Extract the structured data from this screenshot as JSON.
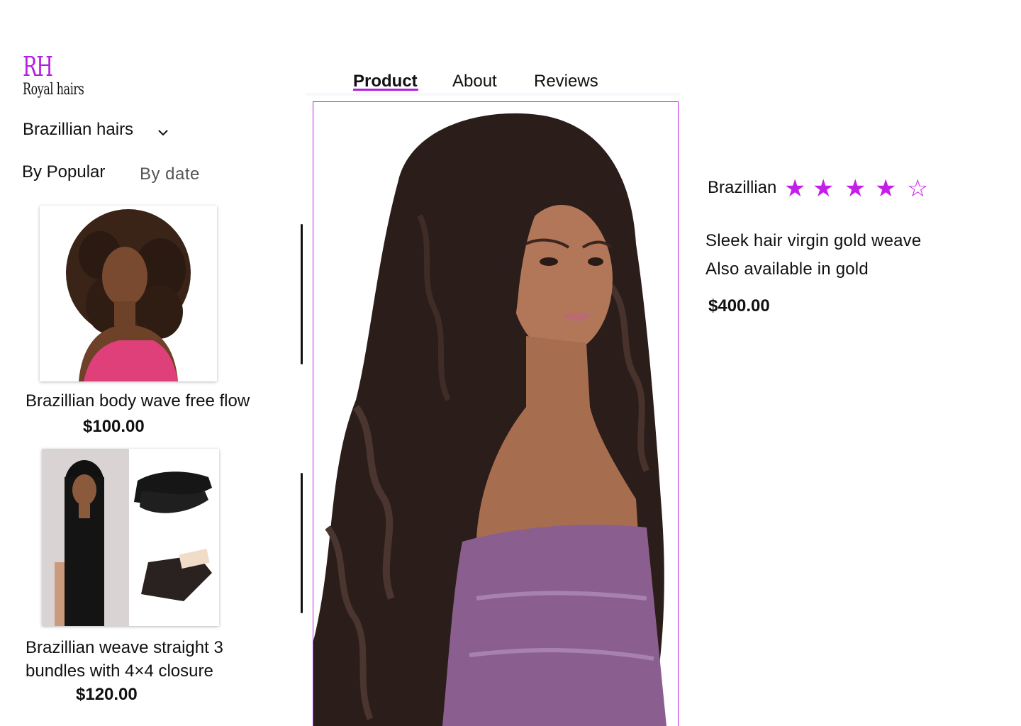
{
  "brand": {
    "mark": "RH",
    "name": "Royal hairs"
  },
  "sidebar": {
    "category": "Brazillian hairs",
    "sort_popular": "By Popular",
    "sort_date": "By date",
    "items": [
      {
        "title": "Brazillian body wave free flow",
        "price": "$100.00"
      },
      {
        "title_line1": "Brazillian weave straight  3",
        "title_line2": "bundles with 4×4 closure",
        "price": "$120.00"
      }
    ]
  },
  "nav": {
    "tabs": [
      "Product",
      "About",
      "Reviews"
    ],
    "active": "Product"
  },
  "product": {
    "brand": "Brazillian",
    "rating": 4,
    "rating_max": 5,
    "star_filled": "★",
    "star_empty": "☆",
    "desc_line1": "Sleek hair virgin gold weave",
    "desc_line2": "Also available in gold",
    "price": "$400.00"
  },
  "colors": {
    "accent": "#c41ee8",
    "logo": "#b31fe0"
  }
}
